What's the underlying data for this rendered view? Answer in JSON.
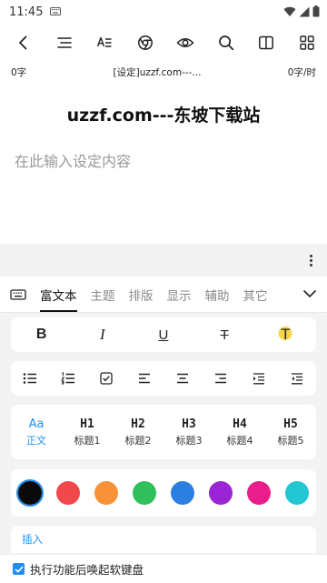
{
  "status_bar": {
    "time": "11:45",
    "icons": [
      "keyboard-icon",
      "wifi-icon",
      "signal-icon",
      "battery-icon"
    ]
  },
  "toolbar": {
    "buttons": [
      "back-icon",
      "outline-icon",
      "text-format-icon",
      "chrome-icon",
      "eye-icon",
      "search-icon",
      "split-view-icon",
      "grid-icon"
    ]
  },
  "info": {
    "char_count": "0字",
    "doc_name": "[设定]uzzf.com---...",
    "speed": "0字/时"
  },
  "document": {
    "title": "uzzf.com---东坡下载站",
    "placeholder": "在此输入设定内容"
  },
  "panel": {
    "tabs": [
      {
        "label": "富文本",
        "active": true
      },
      {
        "label": "主题",
        "active": false
      },
      {
        "label": "排版",
        "active": false
      },
      {
        "label": "显示",
        "active": false
      },
      {
        "label": "辅助",
        "active": false
      },
      {
        "label": "其它",
        "active": false
      }
    ],
    "format_buttons": [
      {
        "glyph": "B",
        "name": "bold-button"
      },
      {
        "glyph": "I",
        "name": "italic-button"
      },
      {
        "glyph": "U",
        "name": "underline-button"
      },
      {
        "glyph": "T",
        "name": "strikethrough-button"
      },
      {
        "glyph": "T",
        "name": "text-highlight-button"
      }
    ],
    "headings": [
      {
        "top": "Aa",
        "bottom": "正文",
        "active": true
      },
      {
        "top": "H1",
        "bottom": "标题1",
        "active": false
      },
      {
        "top": "H2",
        "bottom": "标题2",
        "active": false
      },
      {
        "top": "H3",
        "bottom": "标题3",
        "active": false
      },
      {
        "top": "H4",
        "bottom": "标题4",
        "active": false
      },
      {
        "top": "H5",
        "bottom": "标题5",
        "active": false
      }
    ],
    "colors": [
      "#0a0a0a",
      "#f0484b",
      "#f99138",
      "#2fbf5b",
      "#2b7fe0",
      "#9b24d6",
      "#e91e8c",
      "#22c7d4"
    ],
    "selected_color": "#0a0a0a",
    "insert_label": "插入",
    "accent": "#1f8ef1"
  },
  "footer": {
    "checkbox_label": "执行功能后唤起软键盘",
    "checked": true
  }
}
